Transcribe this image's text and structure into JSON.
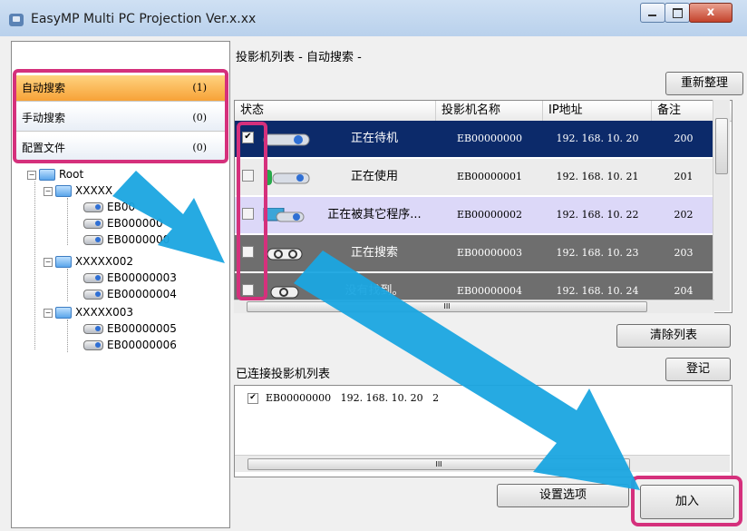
{
  "window": {
    "title": "EasyMP Multi PC Projection Ver.x.xx",
    "close_glyph": "x"
  },
  "sidebar": {
    "categories": [
      {
        "label": "自动搜索",
        "count": "(1)"
      },
      {
        "label": "手动搜索",
        "count": "(0)"
      },
      {
        "label": "配置文件",
        "count": "(0)"
      }
    ],
    "tree": {
      "root": "Root",
      "groups": [
        {
          "label": "XXXXX",
          "items": [
            "EB00",
            "EB000000",
            "EB0000000"
          ]
        },
        {
          "label": "XXXXX002",
          "items": [
            "EB00000003",
            "EB00000004"
          ]
        },
        {
          "label": "XXXXX003",
          "items": [
            "EB00000005",
            "EB00000006"
          ]
        }
      ]
    }
  },
  "main": {
    "list_title": "投影机列表 - 自动搜索 -",
    "refresh_button": "重新整理",
    "columns": [
      "状态",
      "投影机名称",
      "IP地址",
      "备注"
    ],
    "rows": [
      {
        "status": "正在待机",
        "name": "EB00000000",
        "ip": "192. 168. 10. 20",
        "note": "200",
        "checked": "✔"
      },
      {
        "status": "正在使用",
        "name": "EB00000001",
        "ip": "192. 168. 10. 21",
        "note": "201",
        "checked": ""
      },
      {
        "status": "正在被其它程序...",
        "name": "EB00000002",
        "ip": "192. 168. 10. 22",
        "note": "202",
        "checked": ""
      },
      {
        "status": "正在搜索",
        "name": "EB00000003",
        "ip": "192. 168. 10. 23",
        "note": "203",
        "checked": ""
      },
      {
        "status": "没有找到。",
        "name": "EB00000004",
        "ip": "192. 168. 10. 24",
        "note": "204",
        "checked": ""
      }
    ],
    "hscroll_glyph": "III",
    "clear_button": "清除列表",
    "register_button": "登记",
    "connected_title": "已连接投影机列表",
    "connected_items": [
      {
        "checked": "✔",
        "name": "EB00000000",
        "ip": "192. 168. 10. 20",
        "extra": "2"
      }
    ],
    "settings_button": "设置选项",
    "add_button": "加入"
  },
  "colors": {
    "highlight": "#d5307c",
    "arrow": "#1aa5e0",
    "selected_row": "#0c2a6a",
    "selected_category": "#f7a237"
  }
}
